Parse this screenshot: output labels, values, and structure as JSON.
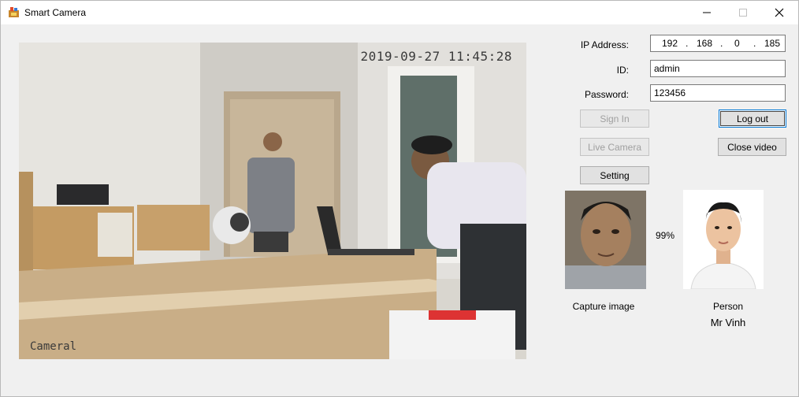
{
  "window": {
    "title": "Smart Camera"
  },
  "video": {
    "timestamp": "2019-09-27 11:45:28",
    "camera_label": "Cameral"
  },
  "form": {
    "ip_label": "IP Address:",
    "ip": [
      "192",
      "168",
      "0",
      "185"
    ],
    "id_label": "ID:",
    "id_value": "admin",
    "password_label": "Password:",
    "password_value": "123456"
  },
  "buttons": {
    "sign_in": "Sign In",
    "log_out": "Log out",
    "live_camera": "Live Camera",
    "close_video": "Close video",
    "setting": "Setting"
  },
  "match": {
    "percent": "99%",
    "capture_label": "Capture image",
    "person_label": "Person",
    "person_name": "Mr Vinh"
  }
}
